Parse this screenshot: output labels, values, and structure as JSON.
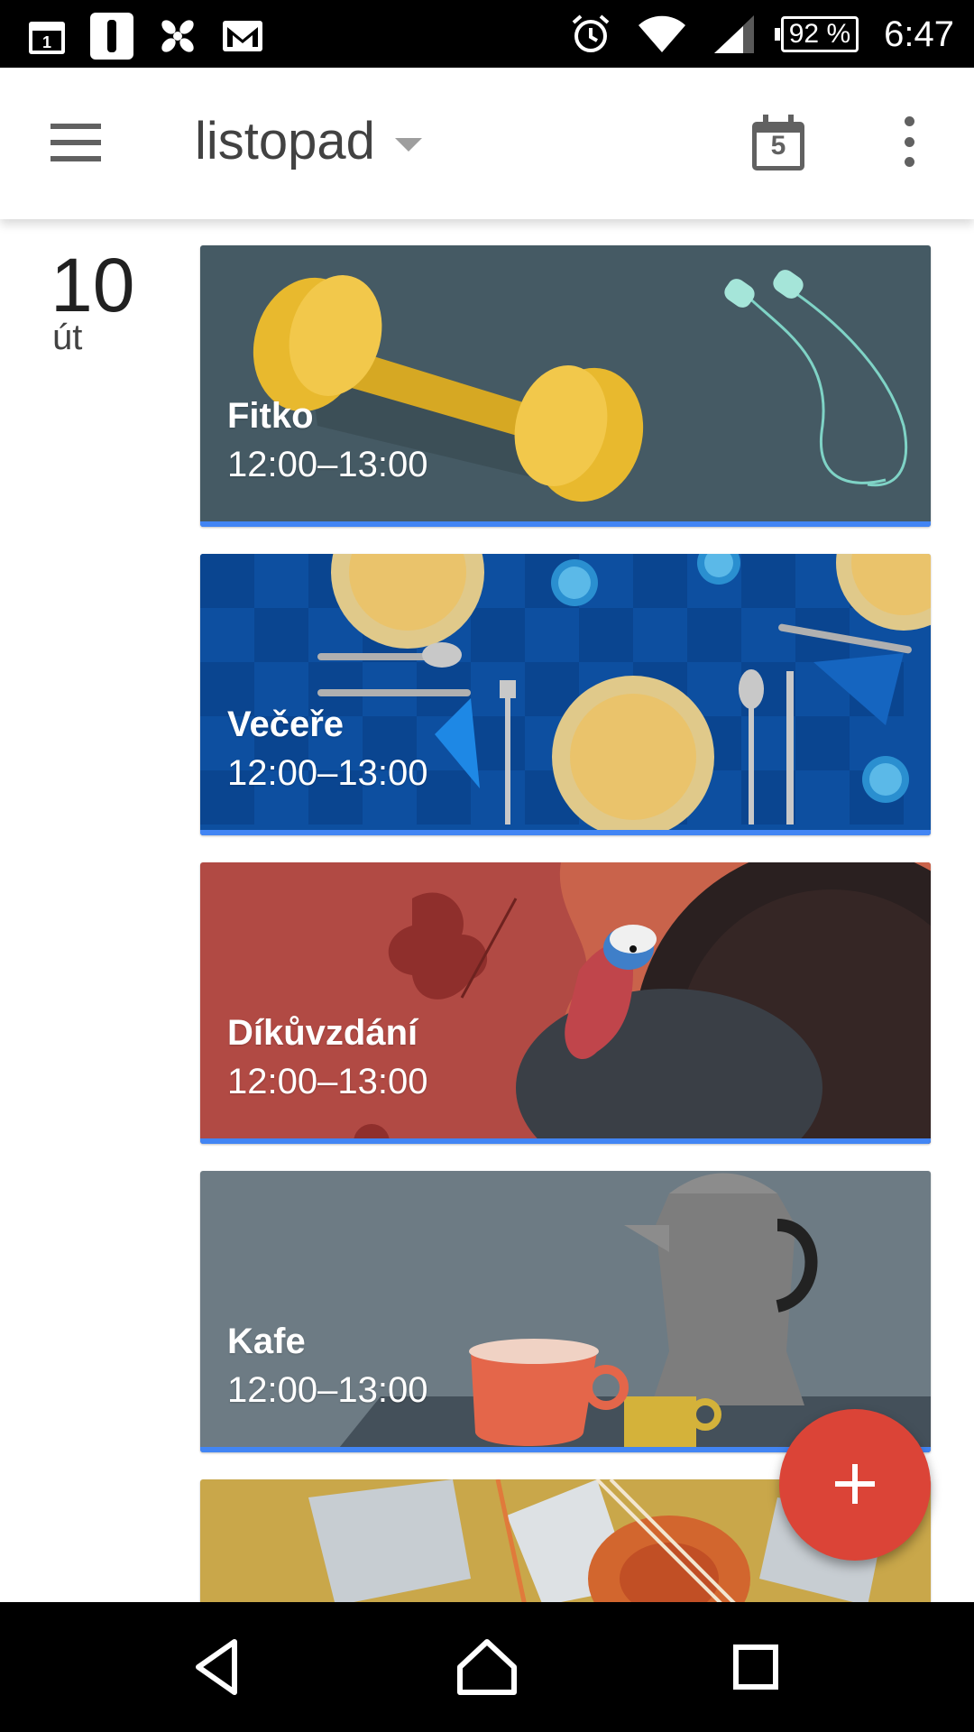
{
  "status_bar": {
    "notification_icons": [
      "calendar-icon",
      "app-icon",
      "pinwheel-icon",
      "gmail-icon"
    ],
    "battery": "92 %",
    "time": "6:47"
  },
  "app_bar": {
    "month": "listopad",
    "today_number": "5"
  },
  "day": {
    "number": "10",
    "weekday": "út"
  },
  "events": [
    {
      "title": "Fitko",
      "time": "12:00–13:00"
    },
    {
      "title": "Večeře",
      "time": "12:00–13:00"
    },
    {
      "title": "Díkůvzdání",
      "time": "12:00–13:00"
    },
    {
      "title": "Kafe",
      "time": "12:00–13:00"
    }
  ],
  "colors": {
    "fab": "#db4437",
    "event_accent": "#4285f4",
    "fitko_bg": "#455a64",
    "vecere_bg": "#0d4fa0",
    "dikuvzdani_bg": "#b14a44",
    "kafe_bg": "#6d7b84",
    "music_bg": "#c9a74a"
  }
}
